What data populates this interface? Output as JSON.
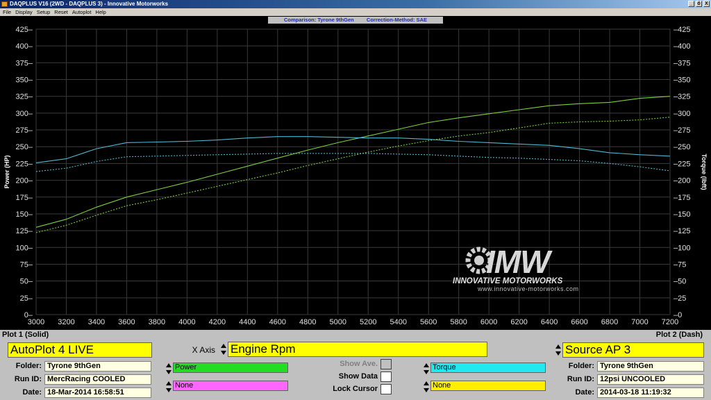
{
  "window": {
    "title": "DAQPLUS V16 (2WD - DAQPLUS 3) - Innovative Motorworks",
    "buttons": [
      "_",
      "ő",
      "X"
    ]
  },
  "menu": [
    "File",
    "Display",
    "Setup",
    "Reset",
    "Autoplot",
    "Help"
  ],
  "plot_header": {
    "comparison": "Comparison: Tyrone 9thGen",
    "correction": "Correction-Method: SAE"
  },
  "watermark": {
    "brand": "IMW",
    "tagline": "INNOVATIVE MOTORWORKS",
    "url": "www.innovative-motorworks.com"
  },
  "colors": {
    "power": "#7ad03a",
    "torque": "#4fb8d0",
    "grid": "#3a3a3a",
    "axis_text": "#e0e0e0"
  },
  "chart_data": {
    "type": "line",
    "ylabel_left": "Power (HP)",
    "ylabel_right": "Torque (lbft)",
    "x_ticks": [
      3000,
      3200,
      3400,
      3600,
      3800,
      4000,
      4200,
      4400,
      4600,
      4800,
      5000,
      5200,
      5400,
      5600,
      5800,
      6000,
      6200,
      6400,
      6600,
      6800,
      7000,
      7200
    ],
    "xlim": [
      3000,
      7200
    ],
    "ylim": [
      0,
      425
    ],
    "y_ticks": [
      0,
      25,
      50,
      75,
      100,
      125,
      150,
      175,
      200,
      225,
      250,
      275,
      300,
      325,
      350,
      375,
      400,
      425
    ],
    "grid": true,
    "series": [
      {
        "name": "Power",
        "run": "MercRacing COOLED",
        "style": "solid",
        "color": "#7ad03a",
        "x": [
          3000,
          3200,
          3400,
          3600,
          3800,
          4000,
          4200,
          4400,
          4600,
          4800,
          5000,
          5200,
          5400,
          5600,
          5800,
          6000,
          6200,
          6400,
          6600,
          6800,
          7000,
          7200
        ],
        "y": [
          130,
          142,
          160,
          175,
          186,
          197,
          209,
          221,
          233,
          245,
          256,
          266,
          276,
          286,
          293,
          299,
          305,
          311,
          314,
          316,
          322,
          325
        ]
      },
      {
        "name": "Torque",
        "run": "MercRacing COOLED",
        "style": "solid",
        "color": "#4fb8d0",
        "x": [
          3000,
          3200,
          3400,
          3600,
          3800,
          4000,
          4200,
          4400,
          4600,
          4800,
          5000,
          5200,
          5400,
          5600,
          5800,
          6000,
          6200,
          6400,
          6600,
          6800,
          7000,
          7200
        ],
        "y": [
          226,
          232,
          247,
          256,
          257,
          258,
          260,
          263,
          265,
          265,
          264,
          263,
          263,
          261,
          258,
          256,
          254,
          252,
          247,
          241,
          238,
          236
        ]
      },
      {
        "name": "Power",
        "run": "12psi UNCOOLED",
        "style": "dash",
        "color": "#7ad03a",
        "x": [
          3000,
          3200,
          3400,
          3600,
          3800,
          4000,
          4200,
          4400,
          4600,
          4800,
          5000,
          5200,
          5400,
          5600,
          5800,
          6000,
          6200,
          6400,
          6600,
          6800,
          7000,
          7200
        ],
        "y": [
          122,
          133,
          148,
          162,
          171,
          181,
          191,
          201,
          211,
          222,
          232,
          242,
          251,
          259,
          266,
          271,
          278,
          285,
          287,
          288,
          290,
          294
        ]
      },
      {
        "name": "Torque",
        "run": "12psi UNCOOLED",
        "style": "dash",
        "color": "#4fb8d0",
        "x": [
          3000,
          3200,
          3400,
          3600,
          3800,
          4000,
          4200,
          4400,
          4600,
          4800,
          5000,
          5200,
          5400,
          5600,
          5800,
          6000,
          6200,
          6400,
          6600,
          6800,
          7000,
          7200
        ],
        "y": [
          213,
          218,
          228,
          235,
          236,
          237,
          238,
          239,
          240,
          240,
          240,
          240,
          239,
          238,
          236,
          234,
          233,
          231,
          229,
          225,
          220,
          214
        ]
      }
    ]
  },
  "bottom": {
    "plot1_label": "Plot 1 (Solid)",
    "plot2_label": "Plot 2 (Dash)",
    "plot1_source": "AutoPlot 4 LIVE",
    "plot2_source": "Source AP 3",
    "x_axis_label": "X Axis",
    "x_axis_value": "Engine Rpm",
    "plot1": {
      "folder_label": "Folder:",
      "folder": "Tyrone 9thGen",
      "runid_label": "Run ID:",
      "runid": "MercRacing COOLED",
      "date_label": "Date:",
      "date": "18-Mar-2014  16:58:51"
    },
    "plot2": {
      "folder_label": "Folder:",
      "folder": "Tyrone 9thGen",
      "runid_label": "Run ID:",
      "runid": "12psi UNCOOLED",
      "date_label": "Date:",
      "date": "2014-03-18  11:19:32"
    },
    "channel1": {
      "label": "Power",
      "color": "#22dd22"
    },
    "channel2": {
      "label": "None",
      "color": "#ff66ff"
    },
    "channel3": {
      "label": "Torque",
      "color": "#22e8f0"
    },
    "channel4": {
      "label": "None",
      "color": "#ffee00"
    },
    "show_ave": "Show Ave.",
    "show_data": "Show Data",
    "lock_cursor": "Lock Cursor"
  }
}
